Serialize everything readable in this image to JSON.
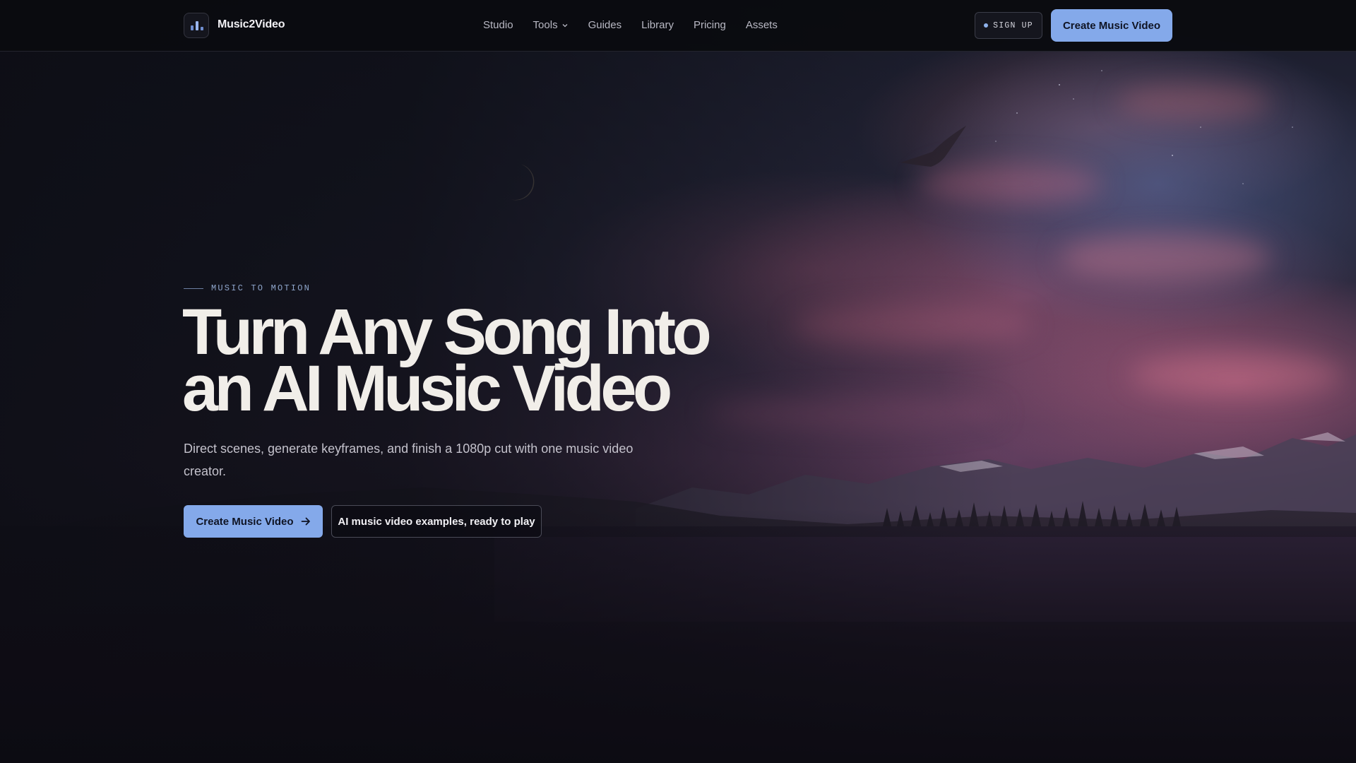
{
  "brand": {
    "name": "Music2Video",
    "logo_icon": "bar-chart-icon"
  },
  "nav": {
    "items": [
      {
        "label": "Studio"
      },
      {
        "label": "Tools",
        "icon": "chevron-down-icon"
      },
      {
        "label": "Guides"
      },
      {
        "label": "Library"
      },
      {
        "label": "Pricing"
      },
      {
        "label": "Assets"
      }
    ]
  },
  "header_actions": {
    "signup_label": "SIGN UP",
    "create_label": "Create Music Video"
  },
  "hero": {
    "eyebrow": "MUSIC TO MOTION",
    "headline_line1": "Turn Any Song Into",
    "headline_line2": "an AI Music Video",
    "subtitle": "Direct scenes, generate keyframes, and finish a 1080p cut with one music video creator.",
    "primary_cta": "Create Music Video",
    "primary_cta_icon": "arrow-right-icon",
    "secondary_cta": "AI music video examples, ready to play"
  },
  "colors": {
    "accent": "#84a9ea",
    "background": "#0b0c12",
    "text": "#f1eee9"
  }
}
